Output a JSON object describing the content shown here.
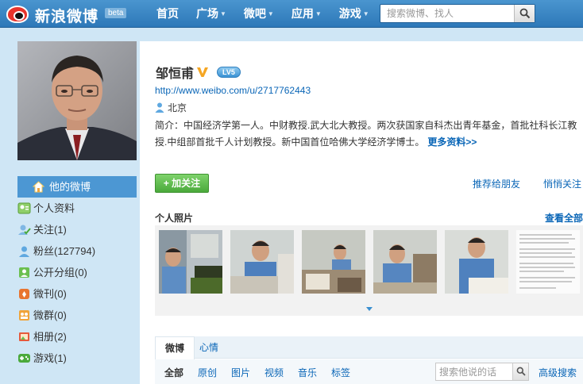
{
  "topbar": {
    "logo_text": "新浪微博",
    "beta": "beta",
    "nav": [
      {
        "label": "首页",
        "dropdown": false
      },
      {
        "label": "广场",
        "dropdown": true
      },
      {
        "label": "微吧",
        "dropdown": true
      },
      {
        "label": "应用",
        "dropdown": true
      },
      {
        "label": "游戏",
        "dropdown": true
      }
    ],
    "search_placeholder": "搜索微博、找人"
  },
  "sidebar": {
    "items": [
      {
        "label": "他的微博",
        "icon": "home-icon"
      },
      {
        "label": "个人资料",
        "icon": "profile-card-icon"
      },
      {
        "label": "关注(1)",
        "icon": "follow-check-icon"
      },
      {
        "label": "粉丝(127794)",
        "icon": "fans-icon"
      },
      {
        "label": "公开分组(0)",
        "icon": "group-icon"
      },
      {
        "label": "微刊(0)",
        "icon": "magazine-icon"
      },
      {
        "label": "微群(0)",
        "icon": "weiqun-icon"
      },
      {
        "label": "相册(2)",
        "icon": "album-icon"
      },
      {
        "label": "游戏(1)",
        "icon": "game-icon"
      }
    ]
  },
  "profile": {
    "name": "邹恒甫",
    "level": "LV5",
    "url": "http://www.weibo.com/u/2717762443",
    "location": "北京",
    "bio": "简介：中国经济学第一人。中财教授.武大北大教授。两次获国家自科杰出青年基金，首批社科长江教授.中组部首批千人计划教授。新中国首位哈佛大学经济学博士。",
    "more_label": "更多资料>>",
    "follow_label": "+ 加关注",
    "recommend_label": "推荐给朋友",
    "secret_follow_label": "悄悄关注"
  },
  "photos": {
    "title": "个人照片",
    "view_all": "查看全部"
  },
  "feed": {
    "tabs": [
      "微博",
      "心情"
    ],
    "filters": [
      "全部",
      "原创",
      "图片",
      "视频",
      "音乐",
      "标签"
    ],
    "search_placeholder": "搜索他说的话",
    "advanced_search": "高级搜索"
  },
  "colors": {
    "topbar": "#2d78b8",
    "link": "#0a66b7",
    "active_sidebar": "#4c97d3",
    "follow_button": "#4aa93b",
    "page_bg": "#cfe6f5"
  }
}
